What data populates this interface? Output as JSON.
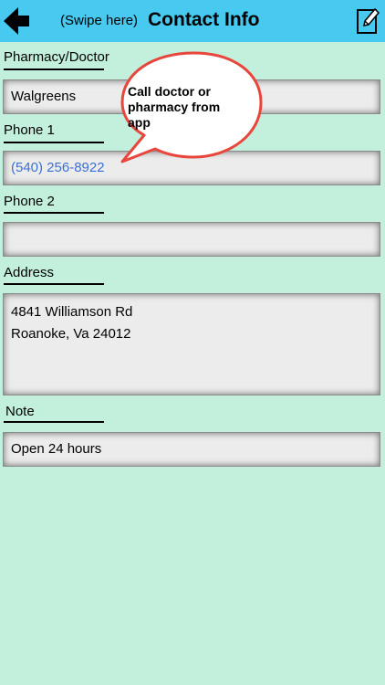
{
  "header": {
    "swipe_hint": "(Swipe here)",
    "title": "Contact Info",
    "back_icon": "arrow-left-icon",
    "edit_icon": "pencil-edit-icon",
    "bar_color": "#47c9f0"
  },
  "form": {
    "pharmacy": {
      "label": "Pharmacy/Doctor",
      "value": "Walgreens"
    },
    "phone1": {
      "label": "Phone 1",
      "value": "(540) 256-8922"
    },
    "phone2": {
      "label": "Phone 2",
      "value": ""
    },
    "address": {
      "label": "Address",
      "line1": "4841 Williamson Rd",
      "line2": "Roanoke, Va 24012"
    },
    "note": {
      "label": "Note",
      "value": "Open 24 hours"
    }
  },
  "callout": {
    "text": "Call doctor or pharmacy from app",
    "border_color": "#e8463c"
  },
  "colors": {
    "background": "#c2f0dc",
    "link": "#3c6fd6"
  }
}
